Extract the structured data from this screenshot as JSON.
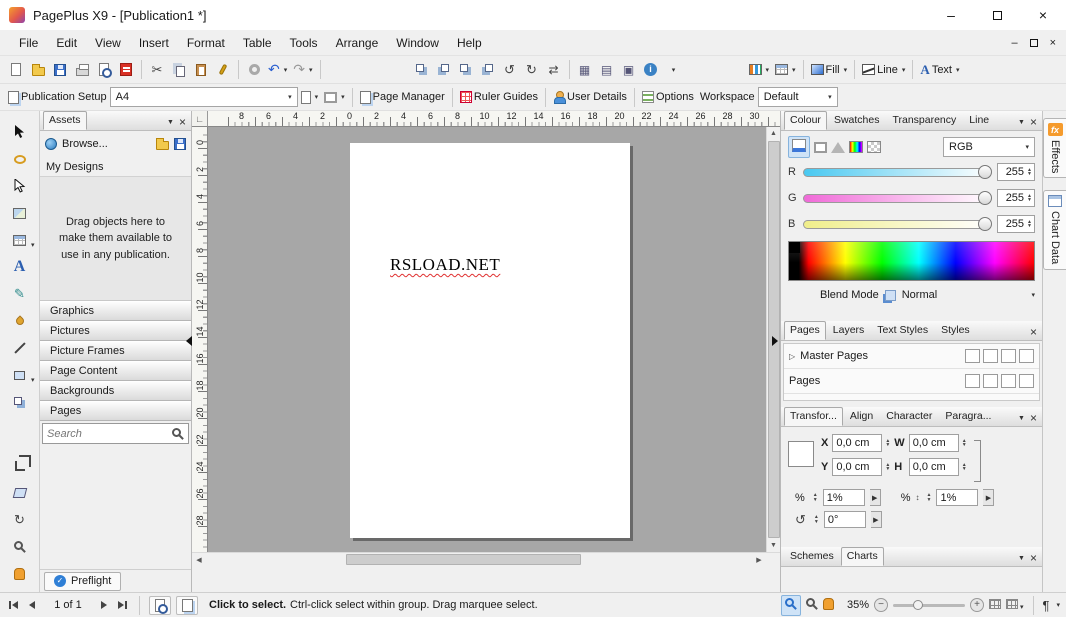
{
  "window": {
    "title": "PagePlus X9 - [Publication1 *]"
  },
  "menubar": {
    "items": [
      "File",
      "Edit",
      "View",
      "Insert",
      "Format",
      "Table",
      "Tools",
      "Arrange",
      "Window",
      "Help"
    ]
  },
  "toolbar1": {
    "fill": "Fill",
    "line": "Line",
    "text": "Text"
  },
  "toolbar2": {
    "publication_setup": "Publication Setup",
    "page_size": "A4",
    "page_manager": "Page Manager",
    "ruler_guides": "Ruler Guides",
    "user_details": "User Details",
    "options": "Options",
    "workspace_label": "Workspace",
    "workspace_value": "Default"
  },
  "assets": {
    "title": "Assets",
    "browse": "Browse...",
    "my_designs": "My Designs",
    "hint": "Drag objects here to make them available to use in any publication.",
    "sections": [
      "Graphics",
      "Pictures",
      "Picture Frames",
      "Page Content",
      "Backgrounds",
      "Pages"
    ],
    "search_placeholder": "Search",
    "preflight": "Preflight"
  },
  "rulers": {
    "horizontal": [
      "8",
      "6",
      "4",
      "2",
      "0",
      "2",
      "4",
      "6",
      "8",
      "10",
      "12",
      "14",
      "16",
      "18",
      "20",
      "22",
      "24",
      "26",
      "28",
      "30"
    ],
    "vertical": [
      "0",
      "2",
      "4",
      "6",
      "8",
      "10",
      "12",
      "14",
      "16",
      "18",
      "20",
      "22",
      "24",
      "26",
      "28"
    ]
  },
  "page": {
    "text": "RSLOAD.NET"
  },
  "colour_panel": {
    "tabs": [
      "Colour",
      "Swatches",
      "Transparency",
      "Line"
    ],
    "mode": "RGB",
    "sliders": [
      {
        "label": "R",
        "value": "255"
      },
      {
        "label": "G",
        "value": "255"
      },
      {
        "label": "B",
        "value": "255"
      }
    ],
    "blend_label": "Blend Mode",
    "blend_value": "Normal"
  },
  "pages_panel": {
    "tabs": [
      "Pages",
      "Layers",
      "Text Styles",
      "Styles"
    ],
    "master_pages": "Master Pages",
    "pages_row": "Pages"
  },
  "transform_panel": {
    "tabs": [
      "Transfor...",
      "Align",
      "Character",
      "Paragra..."
    ],
    "fields": {
      "x_label": "X",
      "x": "0,0 cm",
      "y_label": "Y",
      "y": "0,0 cm",
      "w_label": "W",
      "w": "0,0 cm",
      "h_label": "H",
      "h": "0,0 cm"
    },
    "scale_label": "%",
    "scale_v_label": "%",
    "scale_x": "1%",
    "scale_y": "1%",
    "rotation": "0°"
  },
  "schemes_panel": {
    "tabs": [
      "Schemes",
      "Charts"
    ]
  },
  "side_tabs": [
    {
      "label": "Effects"
    },
    {
      "label": "Chart Data"
    }
  ],
  "statusbar": {
    "page_indicator": "1 of 1",
    "hint_bold": "Click to select.",
    "hint_rest": "Ctrl-click select within group. Drag marquee select.",
    "zoom": "35%"
  }
}
